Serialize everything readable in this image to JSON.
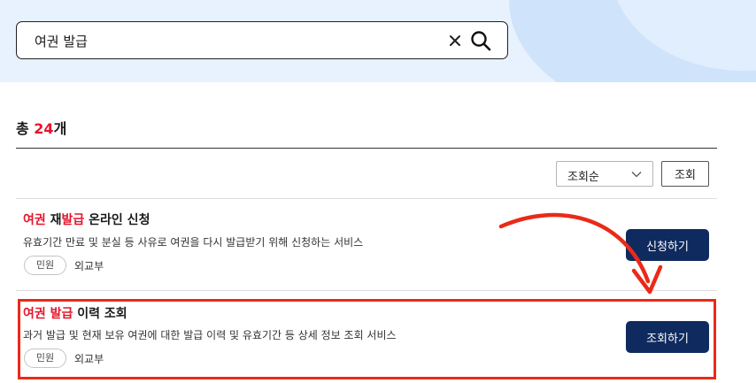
{
  "search": {
    "value": "여권 발급"
  },
  "results": {
    "prefix": "총 ",
    "count": "24",
    "suffix": "개"
  },
  "toolbar": {
    "sort_selected": "조회순",
    "query_button": "조회"
  },
  "items": [
    {
      "title_parts": [
        "여권",
        " 재",
        "발급",
        " 온라인 신청"
      ],
      "description": "유효기간 만료 및 분실 등 사유로 여권을 다시 발급받기 위해 신청하는 서비스",
      "tag": "민원",
      "org": "외교부",
      "action": "신청하기"
    },
    {
      "title_parts": [
        "여권 발급",
        " 이력 조회"
      ],
      "description": "과거 발급 및 현재 보유 여권에 대한 발급 이력 및 유효기간 등 상세 정보 조회 서비스",
      "tag": "민원",
      "org": "외교부",
      "action": "조회하기"
    }
  ],
  "colors": {
    "highlight": "#e4152b",
    "primary_button": "#0f2a5e",
    "annotation": "#ea2a18"
  }
}
